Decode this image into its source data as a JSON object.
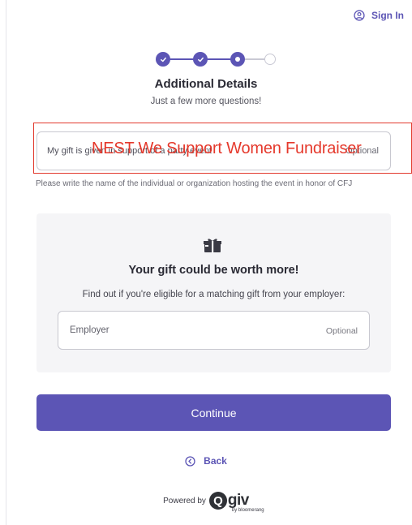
{
  "header": {
    "signin_label": "Sign In",
    "signin_icon": "user-circle-icon"
  },
  "stepper": {
    "steps": [
      "done",
      "done",
      "current",
      "todo"
    ],
    "accent": "#5c55b5"
  },
  "page": {
    "title": "Additional Details",
    "subtitle": "Just a few more questions!"
  },
  "honor_field": {
    "placeholder": "My gift is given in support of a party event",
    "optional": "Optional",
    "overlay_value": "NEST We Support Women Fundraiser",
    "help_text": "Please write the name of the individual or organization hosting the event in honor of CFJ"
  },
  "matching": {
    "icon": "gift-box-icon",
    "title": "Your gift could be worth more!",
    "subtitle": "Find out if you're eligible for a matching gift from your employer:",
    "employer_label": "Employer",
    "employer_optional": "Optional"
  },
  "actions": {
    "continue_label": "Continue",
    "back_label": "Back"
  },
  "footer": {
    "powered_by": "Powered by",
    "brand_q": "Q",
    "brand_giv": "giv",
    "brand_by": "by bloomerang"
  },
  "colors": {
    "accent": "#5c55b5",
    "highlight": "#e23a2e",
    "overlay_text": "#e5392c"
  }
}
